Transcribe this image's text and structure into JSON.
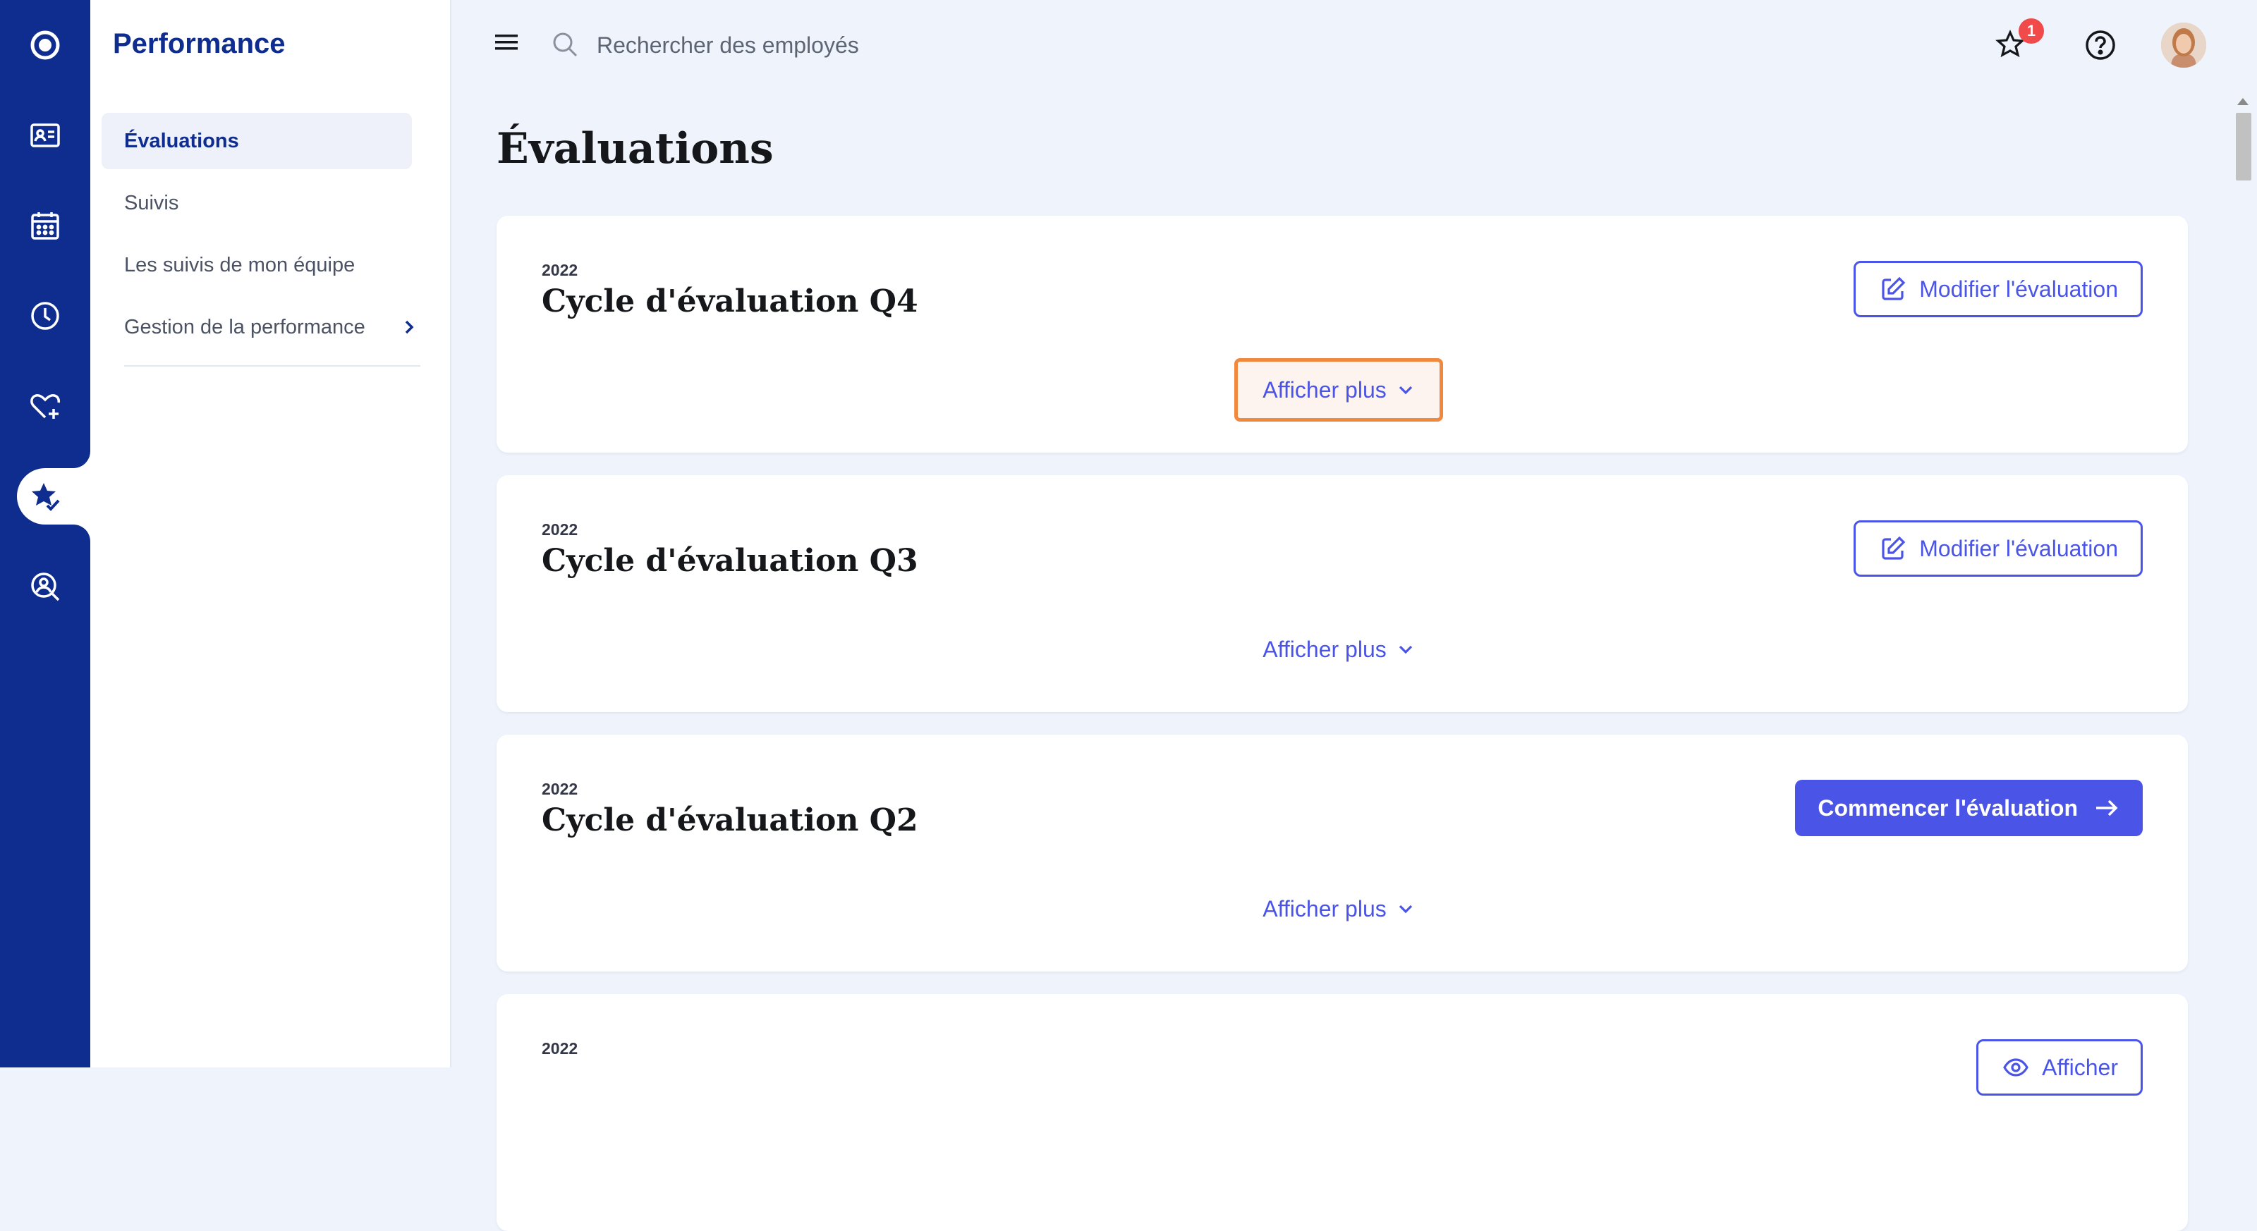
{
  "sidebar": {
    "title": "Performance",
    "items": [
      {
        "label": "Évaluations",
        "active": true
      },
      {
        "label": "Suivis"
      },
      {
        "label": "Les suivis de mon équipe"
      },
      {
        "label": "Gestion de la performance",
        "has_submenu": true
      }
    ]
  },
  "rail": {
    "icons": [
      "logo-icon",
      "id-card-icon",
      "calendar-icon",
      "clock-icon",
      "heart-plus-icon",
      "star-check-icon",
      "search-person-icon"
    ],
    "active_icon": "star-check-icon"
  },
  "topbar": {
    "search_placeholder": "Rechercher des employés",
    "notification_count": "1"
  },
  "page": {
    "title": "Évaluations"
  },
  "cycles": [
    {
      "year": "2022",
      "title": "Cycle d'évaluation Q4",
      "action": "Modifier l'évaluation",
      "action_type": "outline",
      "show_more": "Afficher plus",
      "highlighted": true
    },
    {
      "year": "2022",
      "title": "Cycle d'évaluation Q3",
      "action": "Modifier l'évaluation",
      "action_type": "outline",
      "show_more": "Afficher plus"
    },
    {
      "year": "2022",
      "title": "Cycle d'évaluation Q2",
      "action": "Commencer l'évaluation",
      "action_type": "primary",
      "show_more": "Afficher plus"
    },
    {
      "year": "2022",
      "action": "Afficher",
      "action_type": "outline"
    }
  ],
  "colors": {
    "rail_bg": "#0f2d8e",
    "accent": "#4a55e8",
    "highlight_border": "#f0883e",
    "badge": "#f04a4a",
    "page_bg": "#eff3fb"
  }
}
